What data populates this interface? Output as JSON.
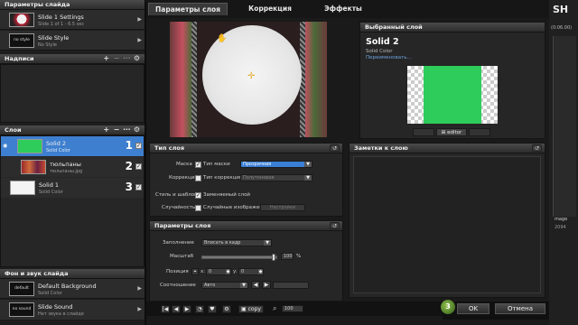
{
  "slide_params": {
    "header": "Параметры слайда",
    "settings_title": "Slide 1 Settings",
    "settings_sub": "Slide 1 of 1 - 6.5 sec",
    "style_thumb": "no style",
    "style_title": "Slide Style",
    "style_sub": "No Style"
  },
  "captions": {
    "header": "Надписи"
  },
  "layers": {
    "header": "Слои",
    "items": [
      {
        "title": "Solid 2",
        "sub": "Solid Color",
        "num": "1"
      },
      {
        "title": "тюльпаны",
        "sub": "тюльпаны.jpg",
        "num": "2"
      },
      {
        "title": "Solid 1",
        "sub": "Solid Color",
        "num": "3"
      }
    ]
  },
  "bg_sound": {
    "header": "Фон и звук слайда",
    "bg_thumb": "default",
    "bg_title": "Default Background",
    "bg_sub": "Solid Color",
    "sound_thumb": "no sound",
    "sound_title": "Slide Sound",
    "sound_sub": "Нет звука в слайде"
  },
  "tabs": [
    "Параметры слоя",
    "Коррекция",
    "Эффекты"
  ],
  "selected_layer": {
    "header": "Выбранный слой",
    "name": "Solid 2",
    "type": "Solid Color",
    "rename": "Переименовать...",
    "editor": "editor",
    "color": "#2ecc5a"
  },
  "layer_type": {
    "header": "Тип слоя",
    "mask_label": "Маска",
    "mask_type": "Тип маски",
    "mask_value": "Прозрачная",
    "correction_label": "Коррекция",
    "correction_type": "Тип коррекции",
    "correction_value": "Полутоновая",
    "style_label": "Стиль и шаблон",
    "style_value": "Заменяемый слой",
    "random_label": "Случайность",
    "random_value": "Случайные изображения",
    "random_extra": "Настройки"
  },
  "layer_params": {
    "header": "Параметры слоя",
    "fill_label": "Заполнение",
    "fill_value": "Вписать в кадр",
    "scale_label": "Масштаб",
    "scale_value": "100",
    "scale_unit": "%",
    "scale_fraction": 1.0,
    "pos_label": "Позиция",
    "pos_x_label": "x:",
    "pos_x": "0",
    "pos_y_label": "y:",
    "pos_y": "0",
    "ratio_label": "Соотношение",
    "ratio_value": "Авто"
  },
  "notes": {
    "header": "Заметки к слою"
  },
  "toolbar": {
    "copy": "copy",
    "zoom": "100"
  },
  "footer": {
    "ok": "OK",
    "cancel": "Отмена"
  },
  "right_edge": {
    "letters": "SH",
    "time": "(0:06.00)",
    "line1": "mage",
    "line2": "2094"
  }
}
